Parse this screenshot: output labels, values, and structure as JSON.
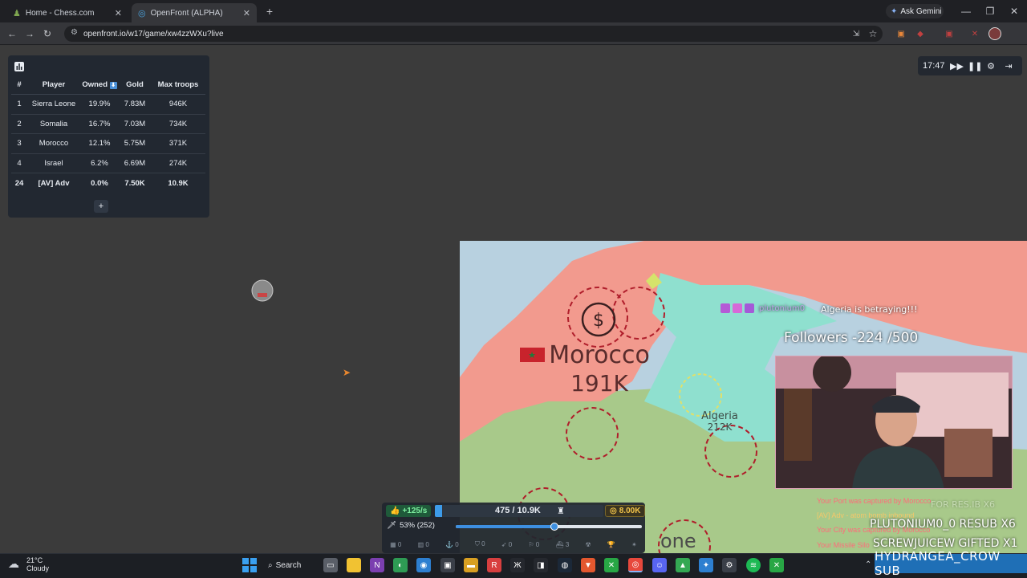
{
  "browser": {
    "tabs": [
      {
        "title": "Home - Chess.com",
        "active": false
      },
      {
        "title": "OpenFront (ALPHA)",
        "active": true
      }
    ],
    "url": "openfront.io/w17/game/xw4zzWXu?live",
    "ask_gemini": "Ask Gemini"
  },
  "leaderboard": {
    "headers": [
      "#",
      "Player",
      "Owned",
      "Gold",
      "Max troops"
    ],
    "rows": [
      {
        "rank": "1",
        "player": "Sierra Leone",
        "owned": "19.9%",
        "gold": "7.83M",
        "troops": "946K"
      },
      {
        "rank": "2",
        "player": "Somalia",
        "owned": "16.7%",
        "gold": "7.03M",
        "troops": "734K"
      },
      {
        "rank": "3",
        "player": "Morocco",
        "owned": "12.1%",
        "gold": "5.75M",
        "troops": "371K"
      },
      {
        "rank": "4",
        "player": "Israel",
        "owned": "6.2%",
        "gold": "6.69M",
        "troops": "274K"
      },
      {
        "rank": "24",
        "player": "[AV] Adv",
        "owned": "0.0%",
        "gold": "7.50K",
        "troops": "10.9K"
      }
    ],
    "expand": "+"
  },
  "controls": {
    "timer": "17:47"
  },
  "map": {
    "morocco_name": "Morocco",
    "morocco_troops": "191K",
    "algeria_name": "Algeria",
    "algeria_troops": "212K",
    "partial_label": "one",
    "colors": {
      "morocco": "#f29a8e",
      "algeria": "#8fe0cf",
      "south": "#a8c98a",
      "sea": "#b8d1e0"
    }
  },
  "overlay": {
    "username": "plutonium0",
    "alert": "Algeria is betraying!!!",
    "followers": "Followers -224 /500",
    "ticker1": "PLUTONIUM0_0  RESUB X6",
    "ticker2": "SCREWJUICEW  GIFTED X1",
    "ticker_faint": "FOR  RES.IB X6"
  },
  "feed": [
    "Your Port was captured by Morocco",
    "[AV] Adv - atom bomb inbound",
    "Your City was captured by Morocco",
    "Your Missile Silo"
  ],
  "hud": {
    "rate": "+125/s",
    "troops": "475 / 10.9K",
    "gold": "8.00K",
    "attack_ratio": "53% (252)",
    "troop_fill": 0.043,
    "slider_level": 0.53,
    "build_counts": [
      "0",
      "0",
      "0",
      "0",
      "0",
      "0",
      "3",
      "",
      ""
    ]
  },
  "taskbar": {
    "weather_temp": "21°C",
    "weather_desc": "Cloudy",
    "search": "Search",
    "sub_alert": "HYDRANGEA_CROW SUB"
  }
}
